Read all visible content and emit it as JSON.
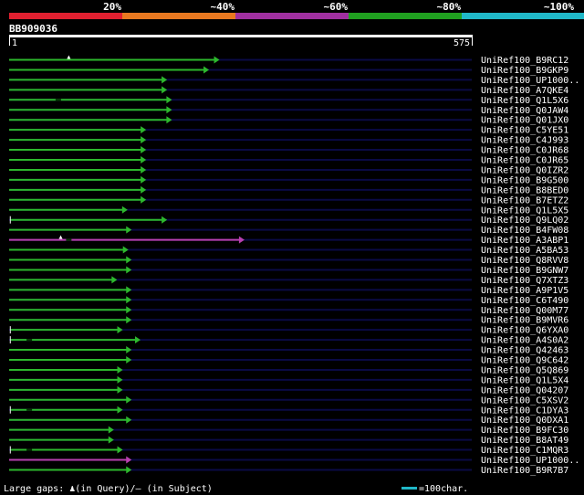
{
  "colors": {
    "background": "#000000",
    "track": "#0a0a46",
    "green": "#2db82d",
    "magenta": "#b840b0",
    "ruler": "#ffffff",
    "legend_bar": "#20b8c8"
  },
  "identity_scale": {
    "labels": [
      "20%",
      "~40%",
      "~60%",
      "~80%",
      "~100%"
    ],
    "colors": [
      "#e02030",
      "#e87820",
      "#a030a0",
      "#20a020",
      "#20b8c8"
    ]
  },
  "query": {
    "name": "BB909036",
    "start_label": "1",
    "end_label": "575",
    "length": 575
  },
  "hits": [
    {
      "label": "UniRef100_B9RC12",
      "end": 262,
      "color": "green",
      "gap": 75
    },
    {
      "label": "UniRef100_B9GKP9",
      "end": 249,
      "color": "green"
    },
    {
      "label": "UniRef100_UP1000..",
      "end": 197,
      "color": "green"
    },
    {
      "label": "UniRef100_A7QKE4",
      "end": 197,
      "color": "green"
    },
    {
      "label": "UniRef100_Q1L5X6",
      "end": 203,
      "color": "green",
      "dash": 62
    },
    {
      "label": "UniRef100_Q0JAW4",
      "end": 203,
      "color": "green"
    },
    {
      "label": "UniRef100_Q01JX0",
      "end": 203,
      "color": "green"
    },
    {
      "label": "UniRef100_C5YE51",
      "end": 171,
      "color": "green"
    },
    {
      "label": "UniRef100_C4J993",
      "end": 171,
      "color": "green"
    },
    {
      "label": "UniRef100_C0JR68",
      "end": 171,
      "color": "green"
    },
    {
      "label": "UniRef100_C0JR65",
      "end": 171,
      "color": "green"
    },
    {
      "label": "UniRef100_Q0IZR2",
      "end": 171,
      "color": "green"
    },
    {
      "label": "UniRef100_B9G500",
      "end": 171,
      "color": "green"
    },
    {
      "label": "UniRef100_B8BED0",
      "end": 171,
      "color": "green"
    },
    {
      "label": "UniRef100_B7ETZ2",
      "end": 171,
      "color": "green"
    },
    {
      "label": "UniRef100_Q1L5X5",
      "end": 148,
      "color": "green"
    },
    {
      "label": "UniRef100_Q9LQ02",
      "start": 3,
      "end": 197,
      "color": "green"
    },
    {
      "label": "UniRef100_B4FW08",
      "end": 153,
      "color": "green"
    },
    {
      "label": "UniRef100_A3ABP1",
      "end": 293,
      "color": "magenta",
      "gap": 65,
      "dash": 75
    },
    {
      "label": "UniRef100_A5BA53",
      "end": 149,
      "color": "green"
    },
    {
      "label": "UniRef100_Q8RVV8",
      "end": 153,
      "color": "green"
    },
    {
      "label": "UniRef100_B9GNW7",
      "end": 153,
      "color": "green"
    },
    {
      "label": "UniRef100_Q7XTZ3",
      "end": 135,
      "color": "green"
    },
    {
      "label": "UniRef100_A9P1V5",
      "end": 153,
      "color": "green"
    },
    {
      "label": "UniRef100_C6T490",
      "end": 153,
      "color": "green"
    },
    {
      "label": "UniRef100_Q00M77",
      "end": 153,
      "color": "green"
    },
    {
      "label": "UniRef100_B9MVR6",
      "end": 153,
      "color": "green"
    },
    {
      "label": "UniRef100_Q6YXA0",
      "start": 3,
      "end": 142,
      "color": "green"
    },
    {
      "label": "UniRef100_A4S0A2",
      "start": 3,
      "end": 164,
      "color": "green",
      "dash": 26
    },
    {
      "label": "UniRef100_Q42463",
      "end": 153,
      "color": "green"
    },
    {
      "label": "UniRef100_Q9C642",
      "end": 153,
      "color": "green"
    },
    {
      "label": "UniRef100_Q5Q869",
      "end": 142,
      "color": "green"
    },
    {
      "label": "UniRef100_Q1L5X4",
      "end": 142,
      "color": "green"
    },
    {
      "label": "UniRef100_Q04207",
      "end": 142,
      "color": "green"
    },
    {
      "label": "UniRef100_C5XSV2",
      "end": 153,
      "color": "green"
    },
    {
      "label": "UniRef100_C1DYA3",
      "start": 3,
      "end": 142,
      "color": "green",
      "dash": 26
    },
    {
      "label": "UniRef100_Q0DXA1",
      "end": 153,
      "color": "green"
    },
    {
      "label": "UniRef100_B9FC30",
      "end": 131,
      "color": "green"
    },
    {
      "label": "UniRef100_B8AT49",
      "end": 131,
      "color": "green"
    },
    {
      "label": "UniRef100_C1MQR3",
      "start": 3,
      "end": 142,
      "color": "green",
      "dash": 26
    },
    {
      "label": "UniRef100_UP1000..",
      "end": 153,
      "color": "magenta"
    },
    {
      "label": "UniRef100_B9R7B7",
      "end": 153,
      "color": "green"
    }
  ],
  "legend": {
    "prefix": "Large gaps: ",
    "query_marker": "♟",
    "query_text": "(in Query)/",
    "subject_marker": "–",
    "subject_text": " (in Subject)",
    "scale_text": "=100char."
  }
}
